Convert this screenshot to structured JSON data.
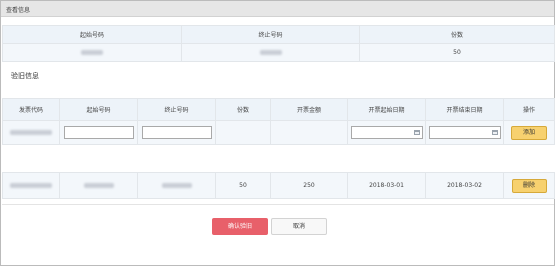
{
  "dialog": {
    "title": "查看信息"
  },
  "info_table": {
    "headers": [
      "起始号码",
      "终止号码",
      "份数"
    ],
    "row": {
      "copies": "50"
    }
  },
  "section_label": "验旧信息",
  "sub_table": {
    "headers": [
      "发票代码",
      "起始号码",
      "终止号码",
      "份数",
      "开票金额",
      "开票起始日期",
      "开票结束日期",
      "操作"
    ],
    "add_label": "添加",
    "rows": [
      {
        "copies": "50",
        "amount": "250",
        "start_date": "2018-03-01",
        "end_date": "2018-03-02",
        "delete_label": "删除"
      }
    ]
  },
  "footer": {
    "confirm_label": "确认验旧",
    "cancel_label": "取消"
  },
  "colors": {
    "confirm": "#e8606a",
    "yellow_button": "#f7d16f",
    "header_bg": "#edf3f9"
  },
  "icons": {
    "date_picker": "calendar-icon"
  }
}
